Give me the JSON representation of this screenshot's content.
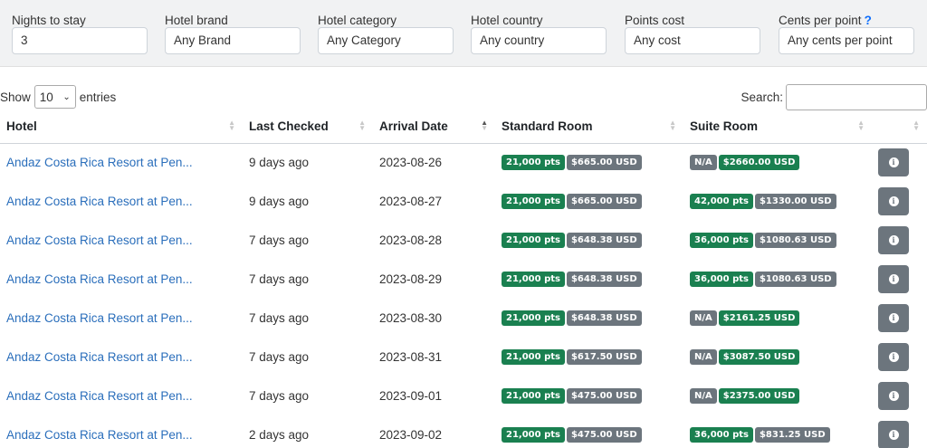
{
  "filters": [
    {
      "label": "Nights to stay",
      "value": "3",
      "help": ""
    },
    {
      "label": "Hotel brand",
      "value": "Any Brand",
      "help": ""
    },
    {
      "label": "Hotel category",
      "value": "Any Category",
      "help": ""
    },
    {
      "label": "Hotel country",
      "value": "Any country",
      "help": ""
    },
    {
      "label": "Points cost",
      "value": "Any cost",
      "help": ""
    },
    {
      "label": "Cents per point",
      "value": "Any cents per point",
      "help": "?"
    }
  ],
  "length": {
    "show": "Show",
    "value": "10",
    "entries": "entries"
  },
  "search": {
    "label": "Search:",
    "value": ""
  },
  "columns": [
    "Hotel",
    "Last Checked",
    "Arrival Date",
    "Standard Room",
    "Suite Room",
    ""
  ],
  "rows": [
    {
      "hotel": "Andaz Costa Rica Resort at Pen...",
      "checked": "9 days ago",
      "date": "2023-08-26",
      "std_pts": "21,000 pts",
      "std_usd": "$665.00 USD",
      "suite_pts": "N/A",
      "suite_usd": "$2660.00 USD"
    },
    {
      "hotel": "Andaz Costa Rica Resort at Pen...",
      "checked": "9 days ago",
      "date": "2023-08-27",
      "std_pts": "21,000 pts",
      "std_usd": "$665.00 USD",
      "suite_pts": "42,000 pts",
      "suite_usd": "$1330.00 USD"
    },
    {
      "hotel": "Andaz Costa Rica Resort at Pen...",
      "checked": "7 days ago",
      "date": "2023-08-28",
      "std_pts": "21,000 pts",
      "std_usd": "$648.38 USD",
      "suite_pts": "36,000 pts",
      "suite_usd": "$1080.63 USD"
    },
    {
      "hotel": "Andaz Costa Rica Resort at Pen...",
      "checked": "7 days ago",
      "date": "2023-08-29",
      "std_pts": "21,000 pts",
      "std_usd": "$648.38 USD",
      "suite_pts": "36,000 pts",
      "suite_usd": "$1080.63 USD"
    },
    {
      "hotel": "Andaz Costa Rica Resort at Pen...",
      "checked": "7 days ago",
      "date": "2023-08-30",
      "std_pts": "21,000 pts",
      "std_usd": "$648.38 USD",
      "suite_pts": "N/A",
      "suite_usd": "$2161.25 USD"
    },
    {
      "hotel": "Andaz Costa Rica Resort at Pen...",
      "checked": "7 days ago",
      "date": "2023-08-31",
      "std_pts": "21,000 pts",
      "std_usd": "$617.50 USD",
      "suite_pts": "N/A",
      "suite_usd": "$3087.50 USD"
    },
    {
      "hotel": "Andaz Costa Rica Resort at Pen...",
      "checked": "7 days ago",
      "date": "2023-09-01",
      "std_pts": "21,000 pts",
      "std_usd": "$475.00 USD",
      "suite_pts": "N/A",
      "suite_usd": "$2375.00 USD"
    },
    {
      "hotel": "Andaz Costa Rica Resort at Pen...",
      "checked": "2 days ago",
      "date": "2023-09-02",
      "std_pts": "21,000 pts",
      "std_usd": "$475.00 USD",
      "suite_pts": "36,000 pts",
      "suite_usd": "$831.25 USD"
    }
  ],
  "icons": {
    "info": "info-icon",
    "sort": "sort-icon",
    "dropdown": "chevron-down-icon"
  },
  "colors": {
    "points_badge": "#1a8050",
    "usd_badge": "#6c757d",
    "link": "#2a6ebb",
    "help": "#0d6efd"
  }
}
